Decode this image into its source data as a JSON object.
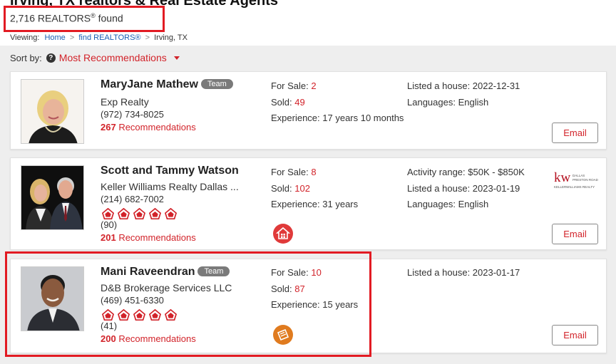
{
  "header": {
    "title": "Irving, TX realtors & Real Estate Agents",
    "results_count": "2,716 REALTORS",
    "results_reg": "®",
    "results_suffix": " found"
  },
  "breadcrumb": {
    "label": "Viewing:",
    "items": [
      "Home",
      "find REALTORS®",
      "Irving, TX"
    ]
  },
  "sort": {
    "label": "Sort by:",
    "help_glyph": "?",
    "selected": "Most Recommendations"
  },
  "agents": [
    {
      "name": "MaryJane Mathew",
      "badge": "Team",
      "company": "Exp Realty",
      "phone": "(972) 734-8025",
      "rec_count": "267",
      "rec_label": " Recommendations",
      "for_sale_label": "For Sale: ",
      "for_sale": "2",
      "sold_label": "Sold: ",
      "sold": "49",
      "experience": "Experience: 17 years 10 months",
      "right_col": [
        "Listed a house: 2022-12-31",
        "Languages: English"
      ],
      "email_label": "Email"
    },
    {
      "name": "Scott and Tammy Watson",
      "company": "Keller Williams Realty Dallas ...",
      "phone": "(214) 682-7002",
      "rating": 5,
      "review_count": "(90)",
      "rec_count": "201",
      "rec_label": " Recommendations",
      "for_sale_label": "For Sale: ",
      "for_sale": "8",
      "sold_label": "Sold: ",
      "sold": "102",
      "experience": "Experience: 31 years",
      "right_col": [
        "Activity range: $50K - $850K",
        "Listed a house: 2023-01-19",
        "Languages: English"
      ],
      "brokerage_logo": {
        "mark": "kw",
        "line1": "DALLAS",
        "line2": "PRESTON ROAD",
        "line3": "KELLERWILLIAMS REALTY"
      },
      "email_label": "Email"
    },
    {
      "name": "Mani Raveendran",
      "badge": "Team",
      "company": "D&B Brokerage Services LLC",
      "phone": "(469) 451-6330",
      "rating": 5,
      "review_count": "(41)",
      "rec_count": "200",
      "rec_label": " Recommendations",
      "for_sale_label": "For Sale: ",
      "for_sale": "10",
      "sold_label": "Sold: ",
      "sold": "87",
      "experience": "Experience: 15 years",
      "right_col": [
        "Listed a house: 2023-01-17"
      ],
      "email_label": "Email"
    }
  ],
  "colors": {
    "accent_red": "#d2232a",
    "highlight_red": "#e21b23",
    "link_blue": "#1a5fb4",
    "badge_gray": "#7a7a7a",
    "certification_icon": "#e03a3a",
    "specialist_icon": "#e07b1f"
  },
  "icons": [
    "help-icon",
    "caret-down-icon",
    "star-icon",
    "home-certification-icon",
    "specialist-badge-icon"
  ]
}
